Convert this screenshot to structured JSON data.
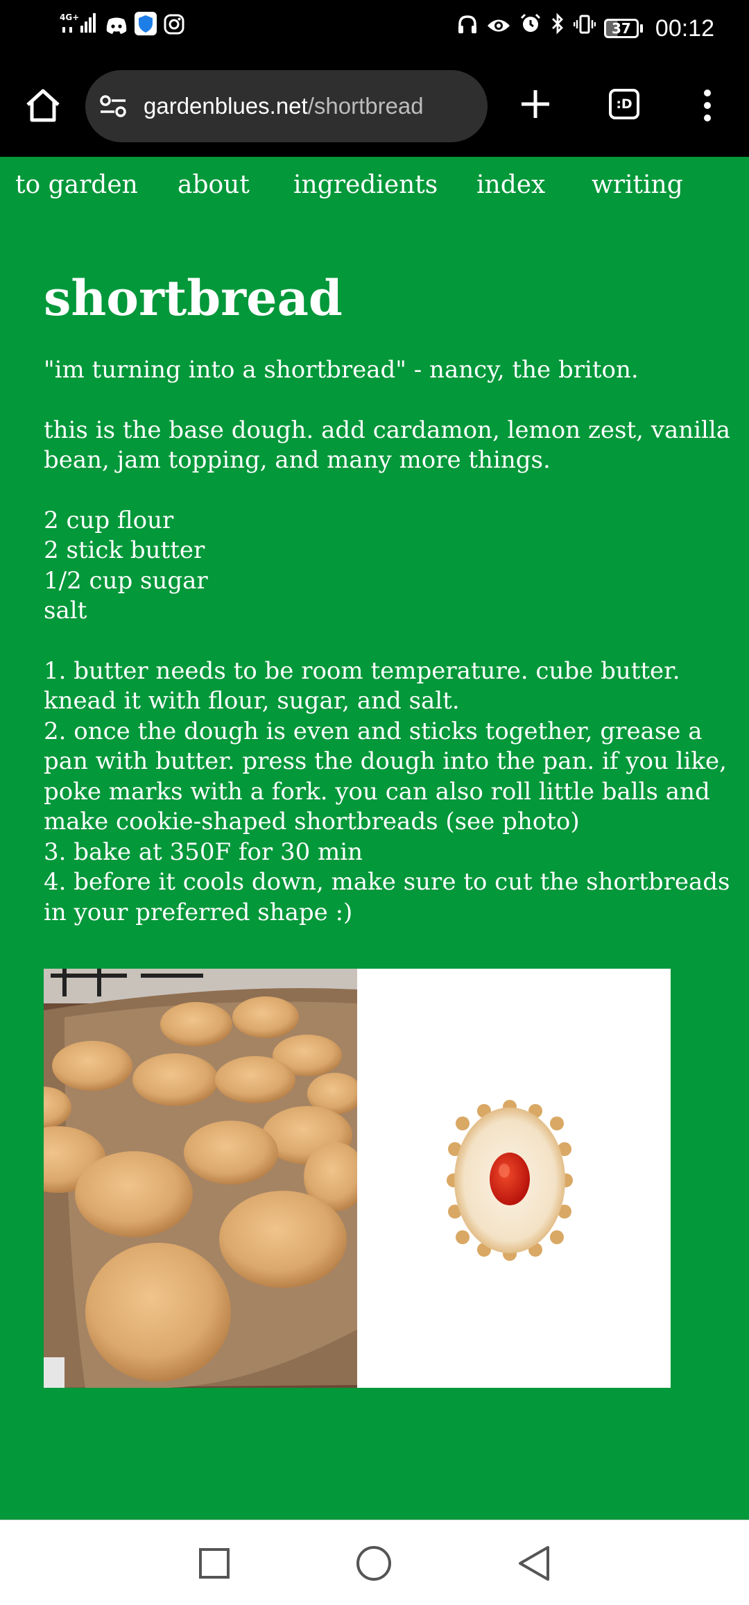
{
  "status_bar": {
    "network": "4G+",
    "time": "00:12",
    "battery": "37",
    "icons_left": [
      "signal-icon",
      "discord-icon",
      "shield-icon",
      "instagram-icon"
    ],
    "icons_right": [
      "headphones-icon",
      "eye-icon",
      "alarm-icon",
      "bluetooth-icon",
      "vibrate-icon",
      "battery-icon"
    ]
  },
  "browser": {
    "url_domain": "gardenblues.net",
    "url_path": "/shortbread",
    "tab_label": ":D"
  },
  "nav": {
    "items": [
      "to garden",
      "about",
      "ingredients",
      "index",
      "writing"
    ]
  },
  "page": {
    "title": "shortbread",
    "quote": "\"im turning into a shortbread\" - nancy, the briton.",
    "intro": "this is the base dough. add cardamon, lemon zest, vanilla bean, jam topping, and many more things.",
    "ingredients": [
      "2 cup flour",
      "2 stick butter",
      "1/2 cup sugar",
      "salt"
    ],
    "steps": [
      "1. butter needs to be room temperature. cube butter. knead it with flour, sugar, and salt.",
      "2. once the dough is even and sticks together, grease a pan with butter. press the dough into the pan. if you like, poke marks with a fork. you can also roll little balls and make cookie-shaped shortbreads (see photo)",
      "3. bake at 350F for 30 min",
      "4. before it cools down, make sure to cut the shortbreads in your preferred shape :)"
    ]
  },
  "colors": {
    "page_bg": "#03983a",
    "browser_bar": "#000000",
    "url_bar": "#2f2f2f"
  }
}
